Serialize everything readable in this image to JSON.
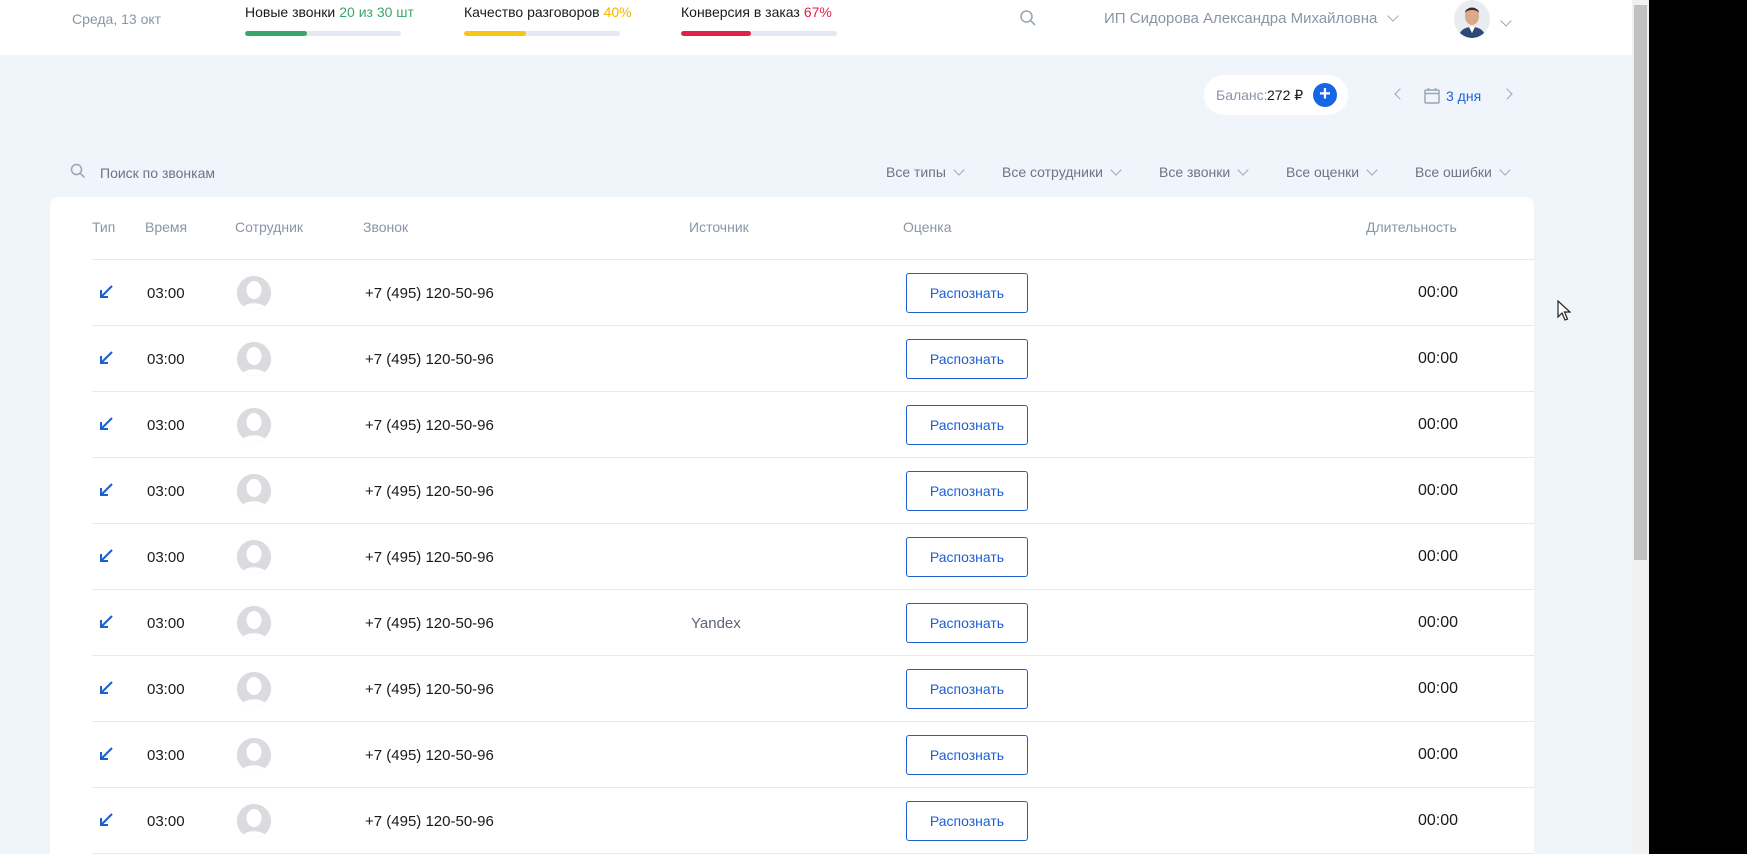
{
  "header": {
    "date": "Среда, 13 окт",
    "metrics": [
      {
        "label": "Новые звонки",
        "value": "20 из 30 шт",
        "color": "#3aa66b",
        "progress": 0.4
      },
      {
        "label": "Качество разговоров",
        "value": "40%",
        "color": "#f5c518",
        "progress": 0.4
      },
      {
        "label": "Конверсия в заказ",
        "value": "67%",
        "color": "#e0214a",
        "progress": 0.45
      }
    ],
    "account_name": "ИП Сидорова Александра Михайловна"
  },
  "balance": {
    "label": "Баланс:",
    "amount": "272 ₽"
  },
  "period": {
    "label": "3 дня"
  },
  "search": {
    "placeholder": "Поиск по звонкам"
  },
  "filters": [
    "Все типы",
    "Все сотрудники",
    "Все звонки",
    "Все оценки",
    "Все ошибки"
  ],
  "table": {
    "columns": {
      "type": "Тип",
      "time": "Время",
      "employee": "Сотрудник",
      "call": "Звонок",
      "source": "Источник",
      "rating": "Оценка",
      "duration": "Длительность"
    },
    "rows": [
      {
        "time": "03:00",
        "phone": "+7 (495) 120-50-96",
        "source": "",
        "action": "Распознать",
        "duration": "00:00"
      },
      {
        "time": "03:00",
        "phone": "+7 (495) 120-50-96",
        "source": "",
        "action": "Распознать",
        "duration": "00:00"
      },
      {
        "time": "03:00",
        "phone": "+7 (495) 120-50-96",
        "source": "",
        "action": "Распознать",
        "duration": "00:00"
      },
      {
        "time": "03:00",
        "phone": "+7 (495) 120-50-96",
        "source": "",
        "action": "Распознать",
        "duration": "00:00"
      },
      {
        "time": "03:00",
        "phone": "+7 (495) 120-50-96",
        "source": "",
        "action": "Распознать",
        "duration": "00:00"
      },
      {
        "time": "03:00",
        "phone": "+7 (495) 120-50-96",
        "source": "Yandex",
        "action": "Распознать",
        "duration": "00:00"
      },
      {
        "time": "03:00",
        "phone": "+7 (495) 120-50-96",
        "source": "",
        "action": "Распознать",
        "duration": "00:00"
      },
      {
        "time": "03:00",
        "phone": "+7 (495) 120-50-96",
        "source": "",
        "action": "Распознать",
        "duration": "00:00"
      },
      {
        "time": "03:00",
        "phone": "+7 (495) 120-50-96",
        "source": "",
        "action": "Распознать",
        "duration": "00:00"
      }
    ]
  },
  "icons": {
    "call_type": "incoming-call-arrow-icon",
    "search": "search-icon",
    "calendar": "calendar-icon",
    "add": "plus-icon"
  }
}
